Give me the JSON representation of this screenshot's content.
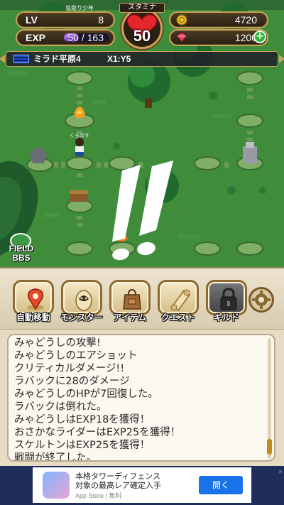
{
  "hud": {
    "player_name": "虫取り少年",
    "lv_label": "LV",
    "lv_value": "8",
    "exp_label": "EXP",
    "exp_value": "50 / 163",
    "exp_fraction": 0.307,
    "stamina_label": "スタミナ",
    "stamina_value": "50",
    "coins": "4720",
    "gems": "1200",
    "plus_symbol": "+"
  },
  "field": {
    "name": "ミラド平原4",
    "coords": "X1:Y5"
  },
  "map": {
    "character_label": "くろのす",
    "bbs_line1": "FIELD",
    "bbs_line2": "BBS"
  },
  "menu": [
    {
      "label": "自動移動",
      "icon": "map-pin-icon"
    },
    {
      "label": "モンスター",
      "icon": "monster-egg-icon"
    },
    {
      "label": "アイテム",
      "icon": "bag-icon"
    },
    {
      "label": "クエスト",
      "icon": "scroll-icon"
    },
    {
      "label": "ギルド",
      "icon": "lock-icon"
    }
  ],
  "log": [
    "みゃどうしの攻撃!",
    "みゃどうしのエアショット",
    "クリティカルダメージ!!",
    "ラバックに28のダメージ",
    "みゃどうしのHPが7回復した。",
    "ラバックは倒れた。",
    "みゃどうしはEXP18を獲得！",
    "おさかなライダーはEXP25を獲得！",
    "スケルトンはEXP25を獲得！",
    "戦闘が終了した。"
  ],
  "ad": {
    "title": "本格タワーディフェンス",
    "subtitle": "対象の最高レア確定入手",
    "store": "App Store | 無料",
    "open_label": "開く",
    "close_symbol": "✕"
  },
  "colors": {
    "grass": "#3e8a3a",
    "gold_border": "#c9a25a",
    "panel": "#e6dcc4",
    "exp_fill": "#7b34d6",
    "ad_button": "#1a73e8"
  }
}
